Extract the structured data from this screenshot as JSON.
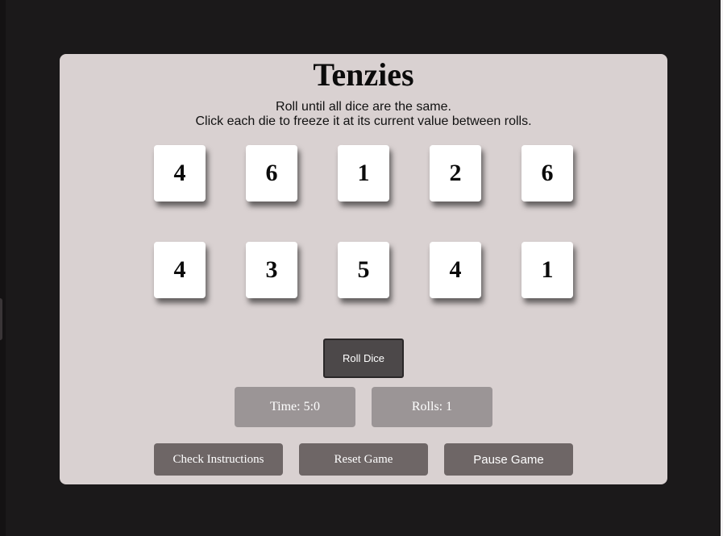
{
  "game": {
    "title": "Tenzies",
    "instructions_line1": "Roll until all dice are the same.",
    "instructions_line2": "Click each die to freeze it at its current value between rolls."
  },
  "dice": [
    {
      "value": "4",
      "held": false
    },
    {
      "value": "6",
      "held": false
    },
    {
      "value": "1",
      "held": false
    },
    {
      "value": "2",
      "held": false
    },
    {
      "value": "6",
      "held": false
    },
    {
      "value": "4",
      "held": false
    },
    {
      "value": "3",
      "held": false
    },
    {
      "value": "5",
      "held": false
    },
    {
      "value": "4",
      "held": false
    },
    {
      "value": "1",
      "held": false
    }
  ],
  "controls": {
    "roll_label": "Roll Dice",
    "check_instructions_label": "Check Instructions",
    "reset_label": "Reset Game",
    "pause_label": "Pause Game"
  },
  "stats": {
    "time_text": "Time: 5:0",
    "rolls_text": "Rolls: 1"
  },
  "colors": {
    "page_background": "#1b191a",
    "board_background": "#d9d1d1",
    "die_face": "#ffffff",
    "roll_button": "#4c4849",
    "stat_box": "#9b9596",
    "action_button": "#6e6666"
  }
}
